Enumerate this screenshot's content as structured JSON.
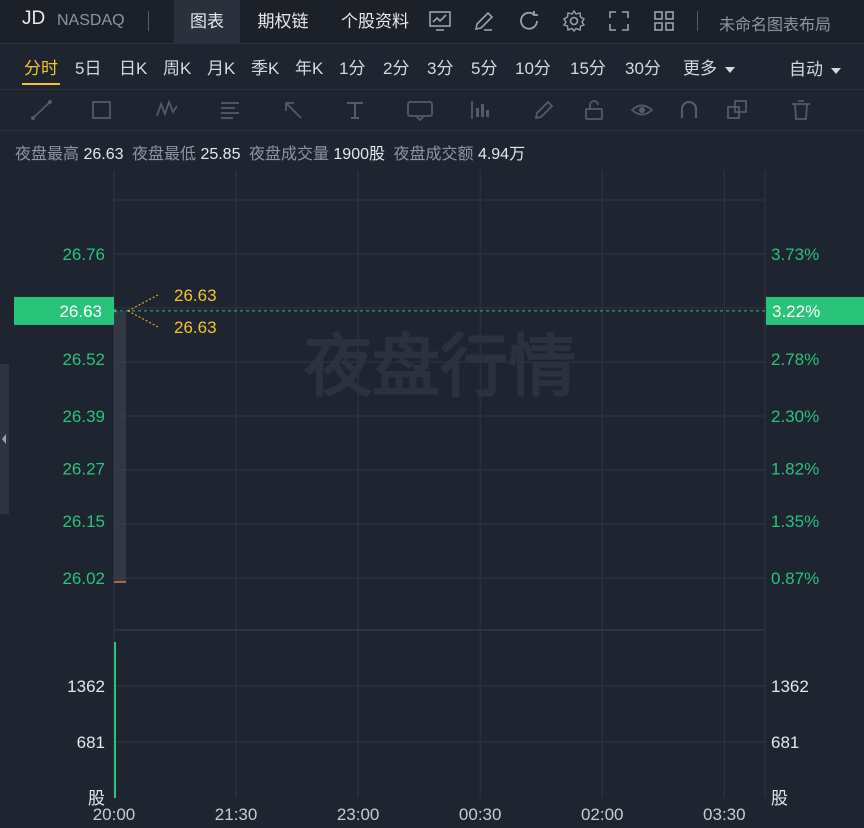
{
  "header": {
    "ticker": "JD",
    "exchange": "NASDAQ",
    "tabs": [
      {
        "label": "图表",
        "active": true
      },
      {
        "label": "期权链",
        "active": false
      },
      {
        "label": "个股资料",
        "active": false
      }
    ],
    "layout_name": "未命名图表布局"
  },
  "periods": {
    "items": [
      "分时",
      "5日",
      "日K",
      "周K",
      "月K",
      "季K",
      "年K",
      "1分",
      "2分",
      "3分",
      "5分",
      "10分",
      "15分",
      "30分",
      "更多"
    ],
    "active": "分时",
    "scale_mode": "自动"
  },
  "info": {
    "high_label": "夜盘最高",
    "high_value": "26.63",
    "low_label": "夜盘最低",
    "low_value": "25.85",
    "volume_label": "夜盘成交量",
    "volume_value": "1900股",
    "amount_label": "夜盘成交额",
    "amount_value": "4.94万"
  },
  "watermark": "夜盘行情",
  "colors": {
    "background": "#1e2430",
    "up_green": "#29c37a",
    "price_label_bg": "#29c37a",
    "annotation_yellow": "#f4c430",
    "grid": "#2f3743"
  },
  "chart_data": {
    "type": "line",
    "x_ticks": [
      "20:00",
      "21:30",
      "23:00",
      "00:30",
      "02:00",
      "03:30"
    ],
    "price_axis": {
      "left_ticks": [
        "26.76",
        "26.63",
        "26.52",
        "26.39",
        "26.27",
        "26.15",
        "26.02"
      ],
      "right_ticks": [
        "3.73%",
        "3.22%",
        "2.78%",
        "2.30%",
        "1.82%",
        "1.35%",
        "0.87%"
      ],
      "current_price": "26.63",
      "current_pct": "3.22%"
    },
    "annotations": [
      {
        "label": "26.63",
        "type": "high"
      },
      {
        "label": "26.63",
        "type": "open"
      }
    ],
    "price_series": [
      {
        "time": "20:00",
        "price": 26.63
      }
    ],
    "volume_axis": {
      "ticks": [
        "1362",
        "681"
      ],
      "unit": "股"
    },
    "volume_series": [
      {
        "time": "20:00",
        "volume": 1900
      }
    ]
  }
}
